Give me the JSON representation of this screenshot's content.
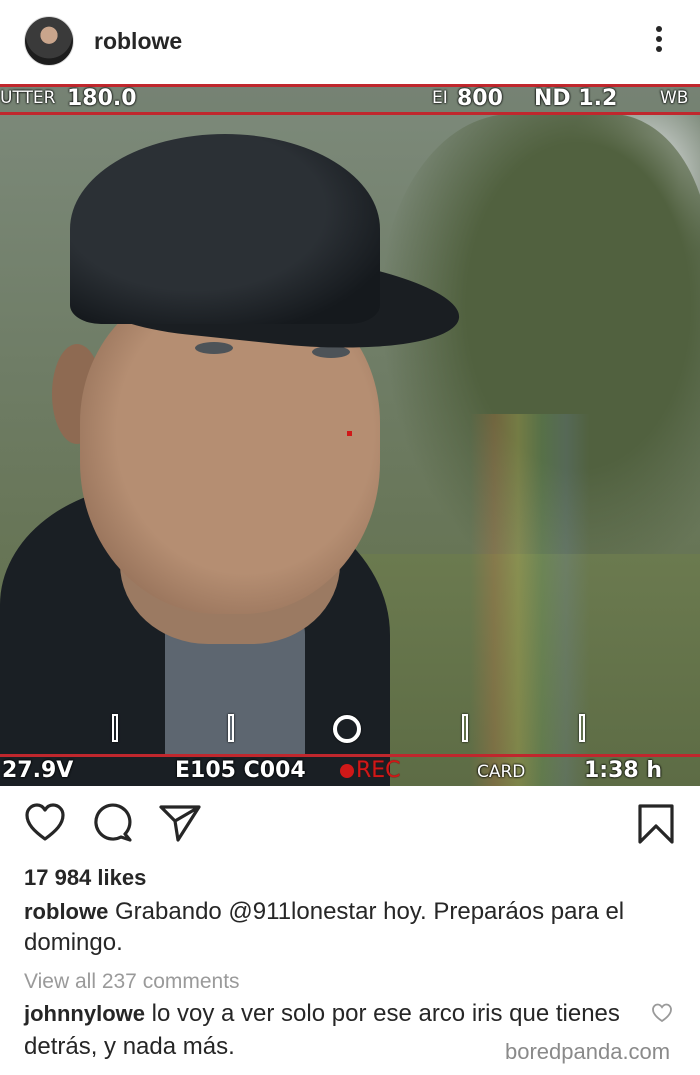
{
  "header": {
    "username": "roblowe"
  },
  "camera_hud": {
    "shutter": "UTTER",
    "shutter_value": "180.0",
    "ei_label": "EI",
    "ei_value": "800",
    "nd": "ND 1.2",
    "wb": "WB",
    "voltage": "27.9V",
    "clip": "E105  C004",
    "rec": "REC",
    "card": "CARD",
    "time": "1:38 h"
  },
  "post": {
    "likes": "17 984 likes",
    "caption_user": "roblowe",
    "caption_text": " Grabando @911lonestar hoy. Preparáos para el domingo.",
    "view_all": "View all 237 comments",
    "comment_user": "johnnylowe",
    "comment_text": " lo voy a ver solo por ese arco iris que tienes detrás, y nada más."
  },
  "watermark": "boredpanda.com",
  "icons": {
    "header": [
      "avatar",
      "more-vertical-icon"
    ],
    "actions": [
      "heart-icon",
      "comment-icon",
      "send-icon",
      "bookmark-icon"
    ],
    "comment": [
      "heart-outline-small-icon"
    ]
  },
  "colors": {
    "hud_red": "#c0272d",
    "rec_red": "#d01818",
    "text": "#262626",
    "muted": "#9a9a9a"
  }
}
